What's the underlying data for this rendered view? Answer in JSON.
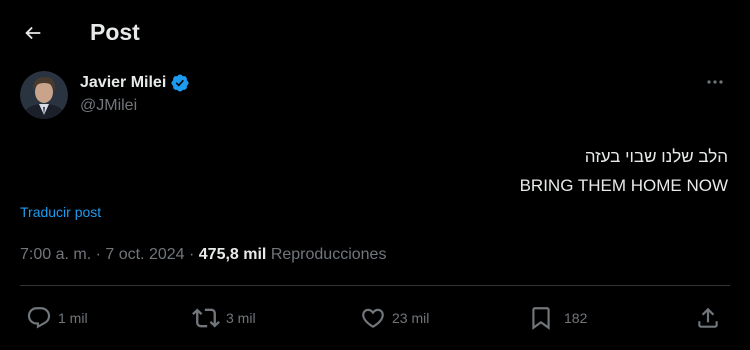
{
  "header": {
    "back_icon": "arrow-left-icon",
    "title": "Post"
  },
  "author": {
    "name": "Javier Milei",
    "handle": "@JMilei",
    "verified_icon": "verified-badge-icon",
    "verified_color": "#1d9bf0"
  },
  "tweet": {
    "lines": [
      "הלב שלנו שבוי בעזה",
      "BRING THEM HOME NOW"
    ],
    "translate_label": "Traducir post"
  },
  "meta": {
    "time": "7:00 a. m.",
    "separator": " · ",
    "date": "7 oct. 2024",
    "separator2": " · ",
    "views_count": "475,8 mil",
    "views_label": "Reproducciones"
  },
  "actions": {
    "reply": {
      "icon": "reply-icon",
      "count": "1 mil"
    },
    "repost": {
      "icon": "repost-icon",
      "count": "3 mil"
    },
    "like": {
      "icon": "heart-icon",
      "count": "23 mil"
    },
    "bookmark": {
      "icon": "bookmark-icon",
      "count": "182"
    },
    "share": {
      "icon": "share-icon"
    }
  },
  "colors": {
    "background": "#000000",
    "text": "#e7e9ea",
    "muted": "#71767b",
    "accent": "#1d9bf0",
    "divider": "#2f3336"
  }
}
